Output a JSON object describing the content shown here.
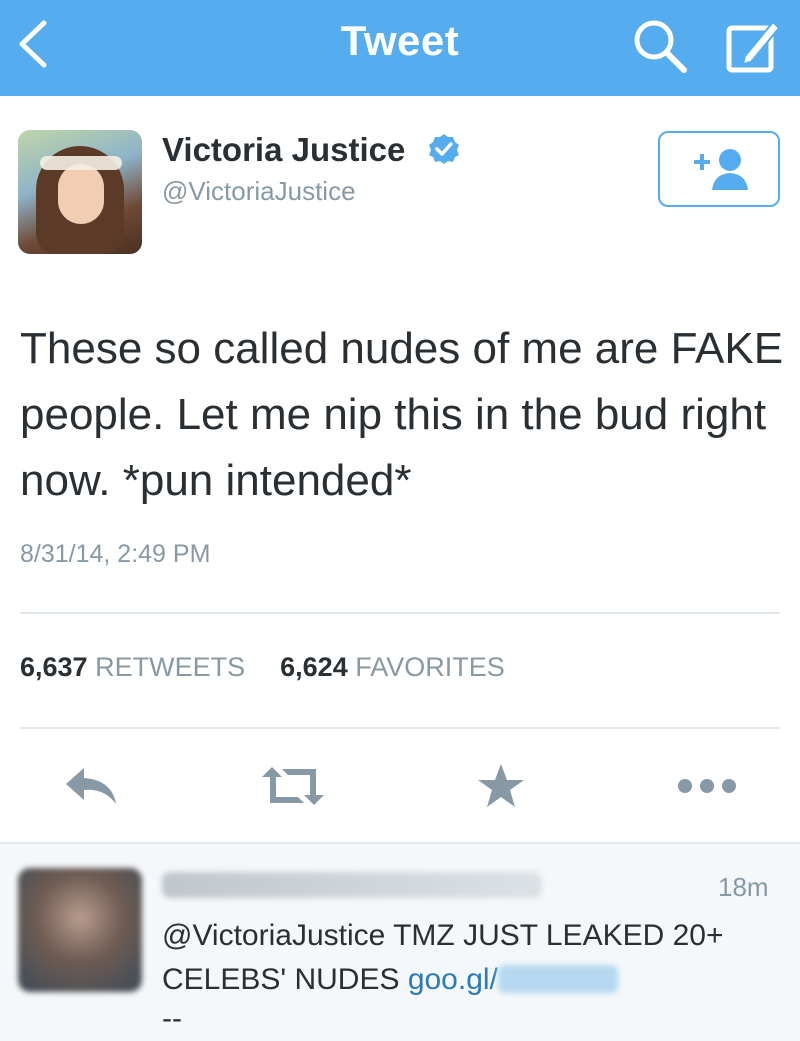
{
  "nav": {
    "title": "Tweet",
    "back_icon": "chevron-left-icon",
    "search_icon": "search-icon",
    "compose_icon": "compose-icon"
  },
  "tweet": {
    "author_name": "Victoria Justice",
    "author_handle": "@VictoriaJustice",
    "verified": true,
    "text": "These so called nudes of me are FAKE people. Let me nip this in the bud right now. *pun intended*",
    "timestamp": "8/31/14, 2:49 PM",
    "retweets_count": "6,637",
    "retweets_label": "RETWEETS",
    "favorites_count": "6,624",
    "favorites_label": "FAVORITES"
  },
  "actions": {
    "reply_icon": "reply-icon",
    "retweet_icon": "retweet-icon",
    "favorite_icon": "star-icon",
    "more_icon": "more-icon"
  },
  "reply": {
    "time": "18m",
    "text_main": "@VictoriaJustice TMZ JUST LEAKED 20+ CELEBS' NUDES ",
    "link": "goo.gl/",
    "tail": "--"
  },
  "colors": {
    "brand": "#55acee",
    "link": "#2b7bb9",
    "muted": "#8899a6",
    "text": "#292f33",
    "divider": "#e1e8ed"
  }
}
